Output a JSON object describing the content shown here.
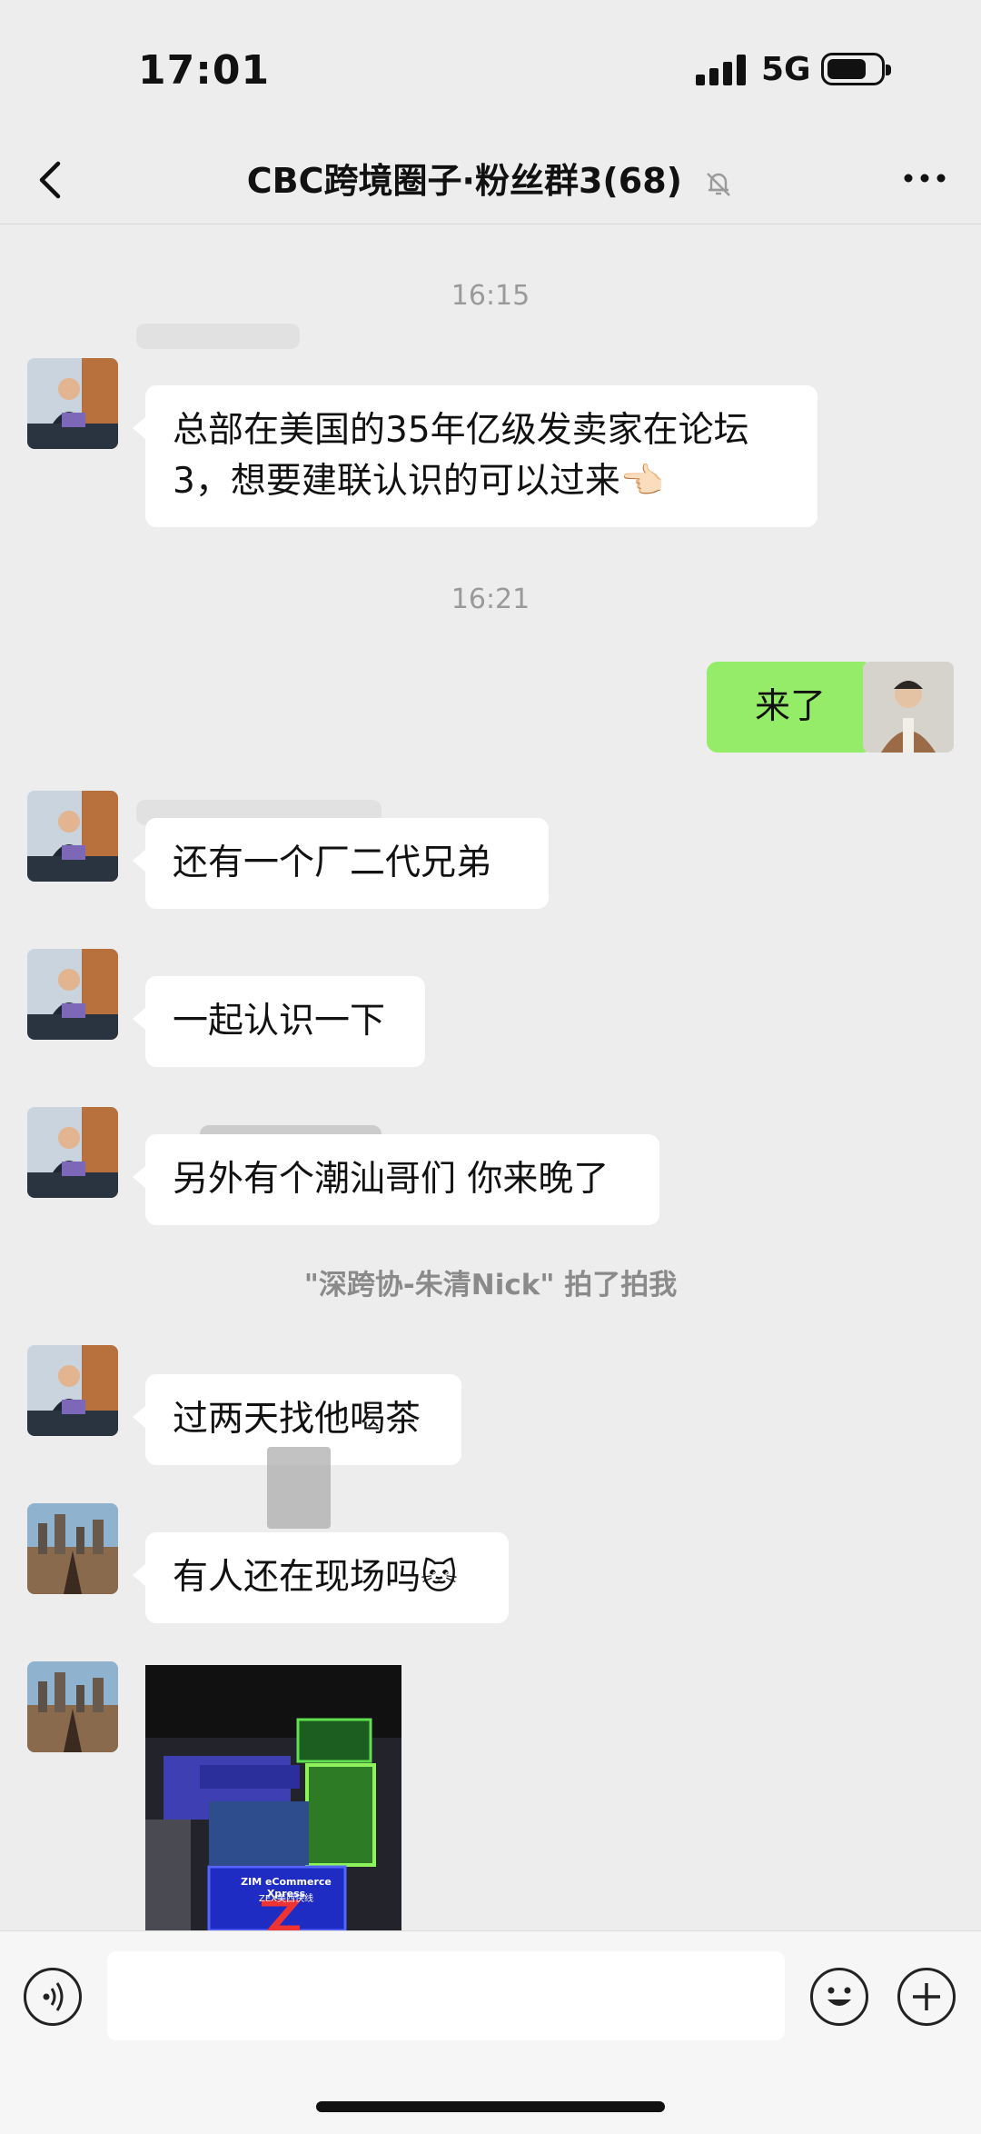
{
  "status_bar": {
    "time": "17:01",
    "network": "5G"
  },
  "header": {
    "title": "CBC跨境圈子·粉丝群3(68)"
  },
  "messages": [
    {
      "type": "timestamp",
      "text": "16:15"
    },
    {
      "type": "left",
      "text": "总部在美国的35年亿级发卖家在论坛3，想要建联认识的可以过来👈🏻"
    },
    {
      "type": "timestamp",
      "text": "16:21"
    },
    {
      "type": "right",
      "text": "来了"
    },
    {
      "type": "left",
      "text": "还有一个厂二代兄弟"
    },
    {
      "type": "left",
      "text": "一起认识一下"
    },
    {
      "type": "left",
      "text": "另外有个潮汕哥们 你来晚了"
    },
    {
      "type": "system",
      "text": "\"深跨协-朱清Nick\" 拍了拍我"
    },
    {
      "type": "left",
      "text": "过两天找他喝茶"
    },
    {
      "type": "left",
      "text": "有人还在现场吗🐱"
    },
    {
      "type": "image",
      "text": "ZIM eCommerce Xpress"
    }
  ],
  "image_sign": {
    "line1": "ZIM eCommerce Xpress",
    "line2": "ZEX美西快线"
  },
  "input": {
    "placeholder": ""
  },
  "colors": {
    "background": "#ededed",
    "sent_bubble": "#95ec69",
    "received_bubble": "#ffffff"
  },
  "icons": [
    "back-arrow-icon",
    "mute-bell-icon",
    "more-dots-icon",
    "voice-icon",
    "emoji-icon",
    "plus-icon"
  ]
}
